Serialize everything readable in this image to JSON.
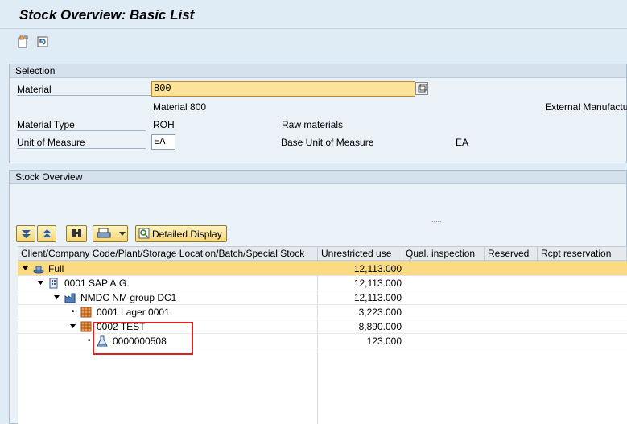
{
  "header": {
    "title": "Stock Overview: Basic List"
  },
  "toolbar": {
    "icons": [
      "new-document-icon",
      "refresh-icon"
    ]
  },
  "selection": {
    "group_title": "Selection",
    "material_label": "Material",
    "material_value": "800",
    "material_description": "Material 800",
    "external_manufacturer_label": "External Manufactu",
    "material_type_label": "Material Type",
    "material_type_value": "ROH",
    "material_type_description": "Raw materials",
    "uom_label": "Unit of Measure",
    "uom_value": "EA",
    "base_uom_label": "Base Unit of Measure",
    "base_uom_value": "EA"
  },
  "stock": {
    "group_title": "Stock Overview",
    "splitter_dots": ".....",
    "detailed_display_label": "Detailed Display",
    "columns": [
      "Client/Company Code/Plant/Storage Location/Batch/Special Stock",
      "Unrestricted use",
      "Qual. inspection",
      "Reserved",
      "Rcpt reservation"
    ],
    "rows": [
      {
        "label": "Full",
        "unrestricted": "12,113.000",
        "icon": "hat-icon"
      },
      {
        "label": "0001 SAP A.G.",
        "unrestricted": "12,113.000",
        "icon": "building-icon"
      },
      {
        "label": "NMDC NM group DC1",
        "unrestricted": "12,113.000",
        "icon": "factory-icon"
      },
      {
        "label": "0001 Lager 0001",
        "unrestricted": "3,223.000",
        "icon": "warehouse-icon"
      },
      {
        "label": "0002 TEST",
        "unrestricted": "8,890.000",
        "icon": "warehouse-icon"
      },
      {
        "label": "0000000508",
        "unrestricted": "123.000",
        "icon": "batch-flask-icon"
      }
    ]
  },
  "colors": {
    "highlight": "#fbdb82",
    "annotation_box": "#e02020"
  }
}
